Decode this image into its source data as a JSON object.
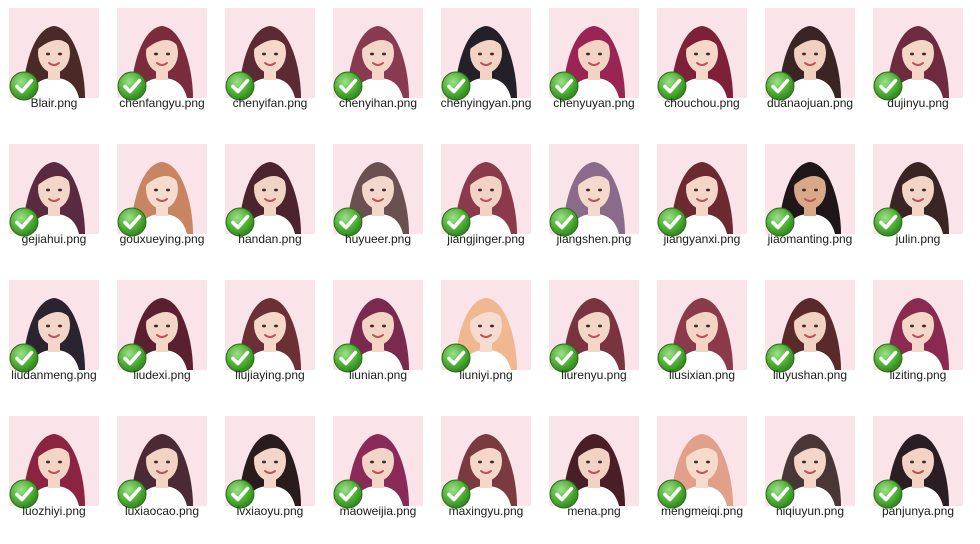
{
  "view": "large-icons",
  "files": [
    {
      "name": "Blair.png",
      "hair": "#4a2a26",
      "skin": "#f3d6c8"
    },
    {
      "name": "chenfangyu.png",
      "hair": "#7a2c3c",
      "skin": "#f4d5c6"
    },
    {
      "name": "chenyifan.png",
      "hair": "#5c2a32",
      "skin": "#f6d8cb"
    },
    {
      "name": "chenyihan.png",
      "hair": "#8a3a50",
      "skin": "#f4d6c8"
    },
    {
      "name": "chenyingyan.png",
      "hair": "#23202a",
      "skin": "#f2d3c4"
    },
    {
      "name": "chenyuyan.png",
      "hair": "#9a2453",
      "skin": "#f3d4c4"
    },
    {
      "name": "chouchou.png",
      "hair": "#7e2038",
      "skin": "#f5d8c9"
    },
    {
      "name": "duanaojuan.png",
      "hair": "#3a2424",
      "skin": "#f1d0bf"
    },
    {
      "name": "dujinyu.png",
      "hair": "#6e2a3e",
      "skin": "#f4d6c7"
    },
    {
      "name": "gejiahui.png",
      "hair": "#5a2a40",
      "skin": "#f4d6c8"
    },
    {
      "name": "gouxueying.png",
      "hair": "#c98462",
      "skin": "#f6dccf"
    },
    {
      "name": "handan.png",
      "hair": "#4b2430",
      "skin": "#f2d4c5"
    },
    {
      "name": "huyueer.png",
      "hair": "#6a5050",
      "skin": "#f3d7ca"
    },
    {
      "name": "jiangjinger.png",
      "hair": "#8a3a4a",
      "skin": "#f2d2c2"
    },
    {
      "name": "jiangshen.png",
      "hair": "#8a6c8a",
      "skin": "#f5d9cc"
    },
    {
      "name": "jiangyanxi.png",
      "hair": "#6a2a30",
      "skin": "#f4d6c8"
    },
    {
      "name": "jiaomanting.png",
      "hair": "#1e1618",
      "skin": "#d9a888"
    },
    {
      "name": "julin.png",
      "hair": "#3a2424",
      "skin": "#f3d5c6"
    },
    {
      "name": "liudanmeng.png",
      "hair": "#2a2430",
      "skin": "#f3d6c8"
    },
    {
      "name": "liudexi.png",
      "hair": "#5a2030",
      "skin": "#f4d6c7"
    },
    {
      "name": "liujiaying.png",
      "hair": "#6a3036",
      "skin": "#f5d8ca"
    },
    {
      "name": "liunian.png",
      "hair": "#7a2a4e",
      "skin": "#f3d5c6"
    },
    {
      "name": "liuniyi.png",
      "hair": "#f0b890",
      "skin": "#f6dcd0"
    },
    {
      "name": "liurenyu.png",
      "hair": "#7a3440",
      "skin": "#f4d6c7"
    },
    {
      "name": "liusixian.png",
      "hair": "#8a3a48",
      "skin": "#f3d4c5"
    },
    {
      "name": "liuyushan.png",
      "hair": "#5a2a2a",
      "skin": "#f2d2c2"
    },
    {
      "name": "liziting.png",
      "hair": "#8a2a50",
      "skin": "#f4d7c9"
    },
    {
      "name": "luozhiyi.png",
      "hair": "#8a2440",
      "skin": "#f3d4c5"
    },
    {
      "name": "luxiaocao.png",
      "hair": "#4a2a34",
      "skin": "#f2d3c4"
    },
    {
      "name": "lvxiaoyu.png",
      "hair": "#2a1c1c",
      "skin": "#f4d6c8"
    },
    {
      "name": "maoweijia.png",
      "hair": "#8a2a58",
      "skin": "#f3d5c7"
    },
    {
      "name": "maxingyu.png",
      "hair": "#7a3a40",
      "skin": "#f4d7c8"
    },
    {
      "name": "mena.png",
      "hair": "#4a1e26",
      "skin": "#f2d2c2"
    },
    {
      "name": "mengmeiqi.png",
      "hair": "#e0a08a",
      "skin": "#f6dbcd"
    },
    {
      "name": "niqiuyun.png",
      "hair": "#4a3636",
      "skin": "#f4d6c8"
    },
    {
      "name": "panjunya.png",
      "hair": "#2a1e24",
      "skin": "#f2d3c4"
    }
  ]
}
